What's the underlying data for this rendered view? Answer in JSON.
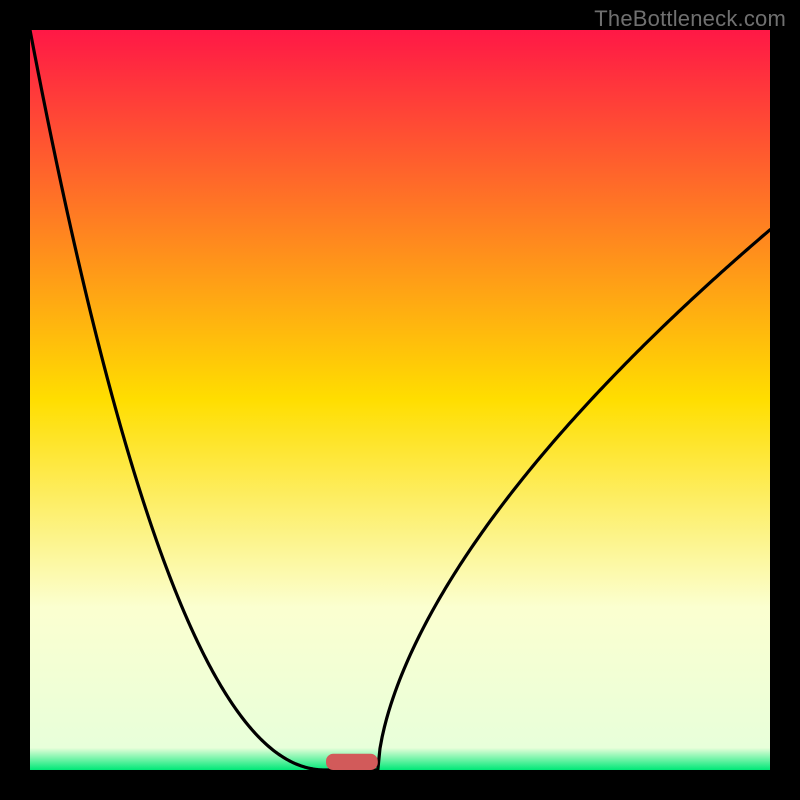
{
  "watermark": "TheBottleneck.com",
  "colors": {
    "top": "#ff1846",
    "mid": "#ffde00",
    "pale": "#fbffd0",
    "green": "#00e878",
    "frame": "#000000",
    "curve": "#000000",
    "marker": "#d25a5a"
  },
  "chart_data": {
    "type": "line",
    "title": "",
    "xlabel": "",
    "ylabel": "",
    "xlim": [
      0,
      1
    ],
    "ylim": [
      0,
      1
    ],
    "notch_x": 0.435,
    "notch_half_width": 0.035,
    "left_top_y_at_x0": 1.0,
    "right_y_at_x1": 0.73,
    "right_curve_exponent": 0.62,
    "left_curve_exponent": 2.1,
    "gradient_stops": [
      {
        "offset": 0.0,
        "color": "#ff1846"
      },
      {
        "offset": 0.5,
        "color": "#ffde00"
      },
      {
        "offset": 0.78,
        "color": "#fbffd0"
      },
      {
        "offset": 0.97,
        "color": "#e8ffda"
      },
      {
        "offset": 1.0,
        "color": "#00e878"
      }
    ],
    "marker": {
      "x": 0.435,
      "w": 0.07,
      "h": 0.022,
      "rx": 0.01
    }
  }
}
